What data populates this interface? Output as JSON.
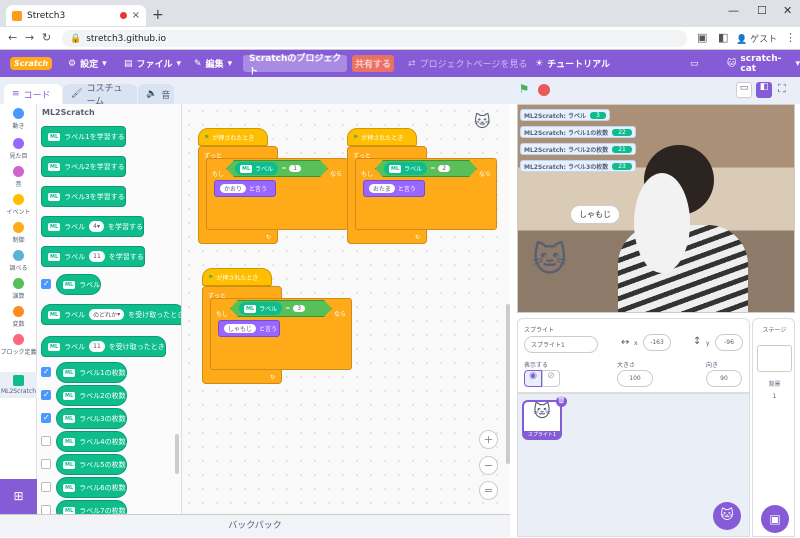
{
  "browser": {
    "tab_title": "Stretch3",
    "url": "stretch3.github.io",
    "guest": "ゲスト"
  },
  "menu": {
    "logo": "Scratch",
    "settings": "設定",
    "file": "ファイル",
    "edit": "編集",
    "project_title": "Scratchのプロジェクト",
    "share": "共有する",
    "project_page": "プロジェクトページを見る",
    "tutorial": "チュートリアル",
    "user": "scratch-cat"
  },
  "tabs": {
    "code": "コード",
    "costume": "コスチューム",
    "sound": "音"
  },
  "categories": [
    {
      "label": "動き",
      "color": "#4c97ff"
    },
    {
      "label": "見た目",
      "color": "#9966ff"
    },
    {
      "label": "音",
      "color": "#cf63cf"
    },
    {
      "label": "イベント",
      "color": "#ffbf00"
    },
    {
      "label": "制御",
      "color": "#ffab19"
    },
    {
      "label": "調べる",
      "color": "#5cb1d6"
    },
    {
      "label": "演算",
      "color": "#59c059"
    },
    {
      "label": "変数",
      "color": "#ff8c1a"
    },
    {
      "label": "ブロック定義",
      "color": "#ff6680"
    },
    {
      "label": "ML2Scratch",
      "color": "#0fbd8c"
    }
  ],
  "palette": {
    "title": "ML2Scratch",
    "learn1": "ラベル1を学習する",
    "learn2": "ラベル2を学習する",
    "learn3": "ラベル3を学習する",
    "learn_prefix": "ラベル",
    "learn_n": "4",
    "learn_suffix": "を学習する",
    "reset_prefix": "ラベル",
    "reset_n": "11",
    "reset_suffix": "を学習する",
    "label": "ラベル",
    "when_prefix": "ラベル",
    "when_dd": "のどれか",
    "when_suffix": "を受け取ったとき",
    "when2_prefix": "ラベル",
    "when2_n": "11",
    "when2_suffix": "を受け取ったとき",
    "counts": [
      "ラベル1の枚数",
      "ラベル2の枚数",
      "ラベル3の枚数",
      "ラベル4の枚数",
      "ラベル5の枚数",
      "ラベル6の枚数",
      "ラベル7の枚数"
    ]
  },
  "scripts": [
    {
      "hat": "が押されたとき",
      "forever": "ずっと",
      "if": "もし",
      "label": "ラベル",
      "eq": "=",
      "value": "1",
      "then": "なら",
      "say_text": "かおり",
      "say": "と言う"
    },
    {
      "hat": "が押されたとき",
      "forever": "ずっと",
      "if": "もし",
      "label": "ラベル",
      "eq": "=",
      "value": "2",
      "then": "なら",
      "say_text": "おたま",
      "say": "と言う"
    },
    {
      "hat": "が押されたとき",
      "forever": "ずっと",
      "if": "もし",
      "label": "ラベル",
      "eq": "=",
      "value": "3",
      "then": "なら",
      "say_text": "しゃもじ",
      "say": "と言う"
    }
  ],
  "ml_badge": "ML",
  "backpack": "バックパック",
  "stage": {
    "monitors": [
      {
        "label": "ML2Scratch: ラベル",
        "value": "3"
      },
      {
        "label": "ML2Scratch: ラベル1の枚数",
        "value": "22"
      },
      {
        "label": "ML2Scratch: ラベル2の枚数",
        "value": "21"
      },
      {
        "label": "ML2Scratch: ラベル3の枚数",
        "value": "23"
      }
    ],
    "bubble": "しゃもじ"
  },
  "sprite": {
    "heading": "スプライト",
    "name": "スプライト1",
    "x_label": "x",
    "x": "-163",
    "y_label": "y",
    "y": "-96",
    "show": "表示する",
    "size_label": "大きさ",
    "size": "100",
    "dir_label": "向き",
    "dir": "90",
    "thumb": "スプライト1"
  },
  "stagepanel": {
    "title": "ステージ",
    "backdrops_label": "背景",
    "backdrops": "1"
  }
}
